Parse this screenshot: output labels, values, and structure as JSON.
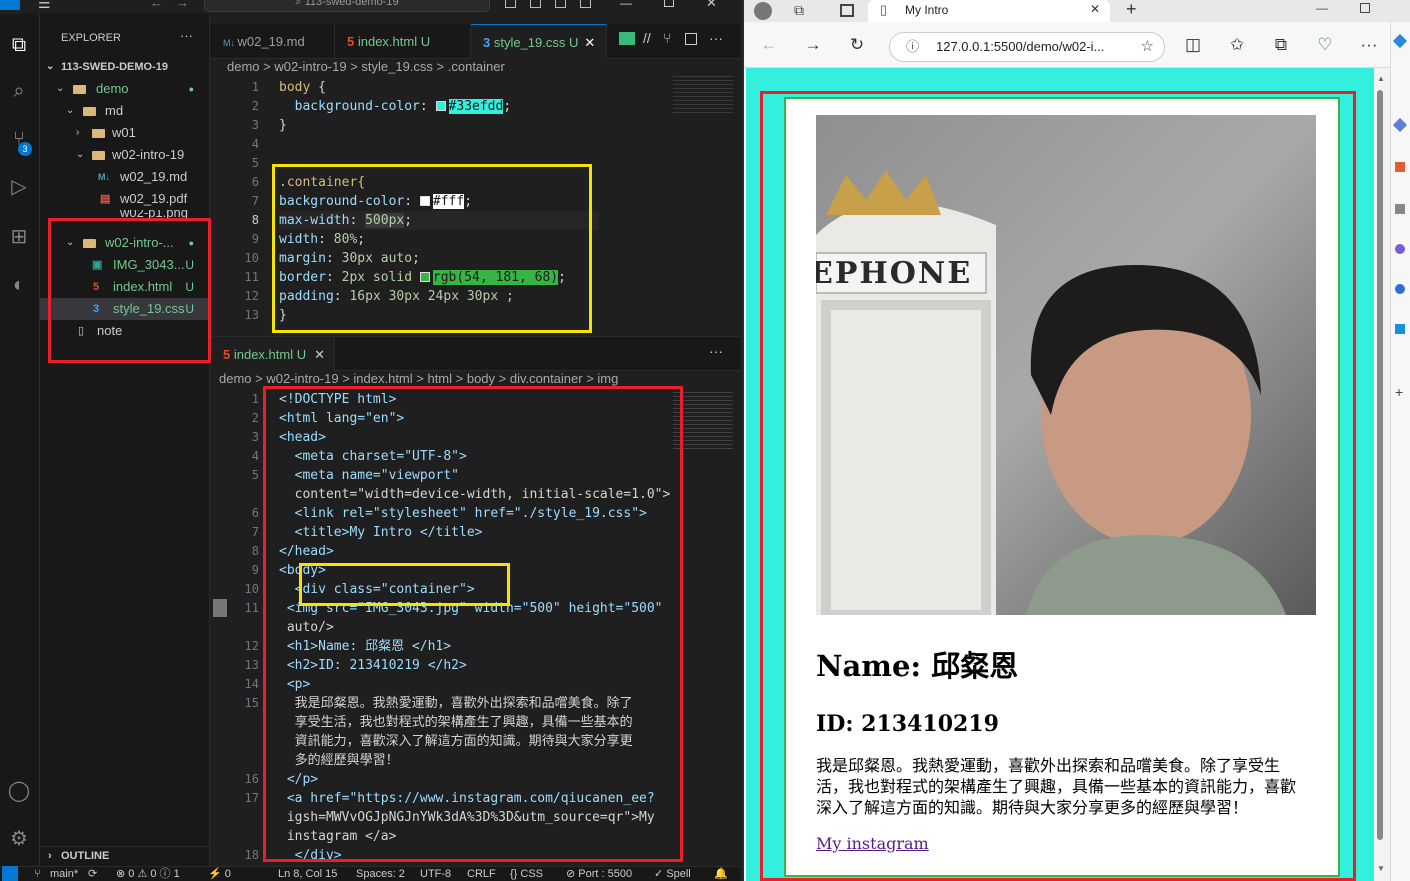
{
  "vscode": {
    "title_search": "113-swed-demo-19",
    "explorer_title": "EXPLORER",
    "workspace": "113-SWED-DEMO-19",
    "tree": [
      {
        "label": "demo",
        "status": "●"
      },
      {
        "label": "md",
        "status": ""
      },
      {
        "label": "w01",
        "status": ""
      },
      {
        "label": "w02-intro-19",
        "status": ""
      },
      {
        "label": "w02_19.md",
        "status": ""
      },
      {
        "label": "w02_19.pdf",
        "status": ""
      },
      {
        "label": "w02-p1.png",
        "status": ""
      },
      {
        "label": "w02-intro-...",
        "status": "●"
      },
      {
        "label": "IMG_3043...",
        "status": "U"
      },
      {
        "label": "index.html",
        "status": "U"
      },
      {
        "label": "style_19.css",
        "status": "U"
      },
      {
        "label": "note",
        "status": ""
      }
    ],
    "outline": "OUTLINE",
    "scm_badge": "3",
    "top_tabs": [
      {
        "label": "w02_19.md"
      },
      {
        "label": "index.html",
        "mod": "U"
      },
      {
        "label": "style_19.css",
        "mod": "U"
      }
    ],
    "top_crumb": "demo  >  w02-intro-19  >  style_19.css  >  .container",
    "css_lines": [
      "1",
      "2",
      "3",
      "4",
      "5",
      "6",
      "7",
      "8",
      "9",
      "10",
      "11",
      "12",
      "13"
    ],
    "css": {
      "l1a": "body",
      "l1b": " {",
      "l2a": "  background-color",
      "l2b": ": ",
      "l2c": "#33efdd",
      "l2d": ";",
      "l3": "}",
      "l6": ".container{",
      "l7a": "background-color",
      "l7b": ": ",
      "l7c": "#fff",
      "l7d": ";",
      "l8a": "max-width",
      "l8b": ": ",
      "l8c": "500px",
      "l8d": ";",
      "l9a": "width",
      "l9b": ": ",
      "l9c": "80%",
      "l9d": ";",
      "l10a": "margin",
      "l10b": ": ",
      "l10c": "30px auto",
      "l10d": ";",
      "l11a": "border",
      "l11b": ": ",
      "l11c": "2px solid ",
      "l11d": "rgb(54, 181, 68)",
      "l11e": ";",
      "l12a": "padding",
      "l12b": ": ",
      "l12c": "16px 30px 24px 30px ;",
      "l13": "}"
    },
    "bottom_tab": "index.html",
    "bottom_tab_mod": "U",
    "bottom_crumb": "demo  >  w02-intro-19  >  index.html  >  html  >  body  >  div.container  >  img",
    "html_lines": [
      "1",
      "2",
      "3",
      "4",
      "5",
      "",
      "6",
      "7",
      "8",
      "9",
      "10",
      "11",
      "",
      "12",
      "13",
      "14",
      "15",
      "",
      "",
      "",
      "16",
      "17",
      "",
      "",
      "18"
    ],
    "html": [
      "<!DOCTYPE html>",
      "<html lang=\"en\">",
      "<head>",
      "  <meta charset=\"UTF-8\">",
      "  <meta name=\"viewport\"",
      "  content=\"width=device-width, initial-scale=1.0\">",
      "  <link rel=\"stylesheet\" href=\"./style_19.css\">",
      "  <title>My Intro </title>",
      "</head>",
      "<body>",
      "  <div class=\"container\">",
      " <img src=\"IMG_3043.jpg\" width=\"500\" height=\"500\"",
      " auto/>",
      " <h1>Name: 邱粲恩 </h1>",
      " <h2>ID: 213410219 </h2>",
      " <p>",
      "  我是邱粲恩。我熱愛運動，喜歡外出探索和品嚐美食。除了",
      "  享受生活，我也對程式的架構產生了興趣，具備一些基本的",
      "  資訊能力，喜歡深入了解這方面的知識。期待與大家分享更",
      "  多的經歷與學習！",
      " </p>",
      " <a href=\"https://www.instagram.com/qiucanen_ee?",
      " igsh=MWVvOGJpNGJnYWk3dA%3D%3D&utm_source=qr\">My",
      " instagram </a>",
      "  </div>"
    ],
    "status": {
      "branch": "main*",
      "problems": "⊗ 0 ⚠ 0 ⓘ 1",
      "ports": "⚡ 0",
      "position": "Ln 8, Col 15",
      "spaces": "Spaces: 2",
      "encoding": "UTF-8",
      "eol": "CRLF",
      "lang": "{} CSS",
      "port": "⊘ Port : 5500",
      "spell": "✓ Spell"
    }
  },
  "browser": {
    "tab_title": "My Intro",
    "url": "127.0.0.1:5500/demo/w02-i...",
    "page": {
      "h1": "Name: 邱粲恩",
      "h2": "ID: 213410219",
      "para": "我是邱粲恩。我熱愛運動，喜歡外出探索和品嚐美食。除了享受生活，我也對程式的架構產生了興趣，具備一些基本的資訊能力，喜歡深入了解這方面的知識。期待與大家分享更多的經歷與學習！",
      "link": "My instagram",
      "sign_text": "EPHONE"
    }
  },
  "colors": {
    "page_bg": "#33efdd",
    "container_border": "#36b544",
    "annotation_red": "#e8202a",
    "annotation_yellow": "#f5e400"
  }
}
